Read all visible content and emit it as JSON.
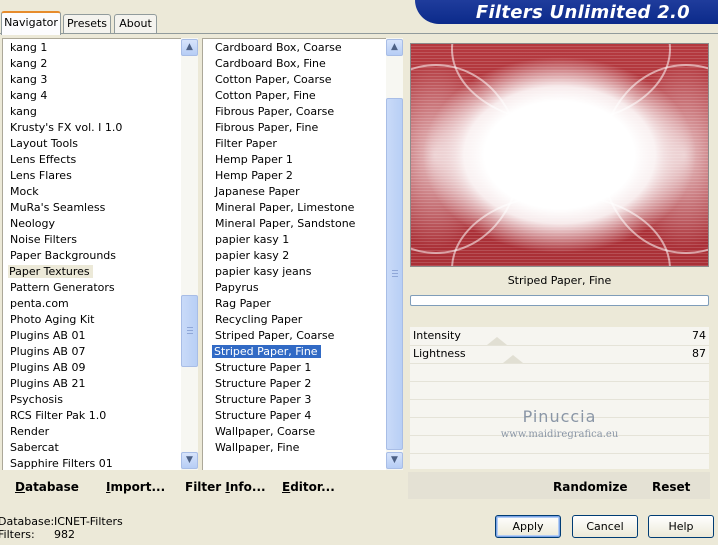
{
  "banner": {
    "title": "Filters Unlimited 2.0"
  },
  "tabs": [
    {
      "label": "Navigator",
      "active": true
    },
    {
      "label": "Presets",
      "active": false
    },
    {
      "label": "About",
      "active": false
    }
  ],
  "categories": {
    "items": [
      "kang 1",
      "kang 2",
      "kang 3",
      "kang 4",
      "kang",
      "Krusty's FX vol. I 1.0",
      "Layout Tools",
      "Lens Effects",
      "Lens Flares",
      "Mock",
      "MuRa's Seamless",
      "Neology",
      "Noise Filters",
      "Paper Backgrounds",
      "Paper Textures",
      "Pattern Generators",
      "penta.com",
      "Photo Aging Kit",
      "Plugins AB 01",
      "Plugins AB 07",
      "Plugins AB 09",
      "Plugins AB 21",
      "Psychosis",
      "RCS Filter Pak 1.0",
      "Render",
      "Sabercat",
      "Sapphire Filters 01"
    ],
    "selected": "Paper Textures"
  },
  "filters": {
    "items": [
      "Cardboard Box, Coarse",
      "Cardboard Box, Fine",
      "Cotton Paper, Coarse",
      "Cotton Paper, Fine",
      "Fibrous Paper, Coarse",
      "Fibrous Paper, Fine",
      "Filter Paper",
      "Hemp Paper 1",
      "Hemp Paper 2",
      "Japanese Paper",
      "Mineral Paper, Limestone",
      "Mineral Paper, Sandstone",
      "papier kasy 1",
      "papier kasy 2",
      "papier kasy jeans",
      "Papyrus",
      "Rag Paper",
      "Recycling Paper",
      "Striped Paper, Coarse",
      "Striped Paper, Fine",
      "Structure Paper 1",
      "Structure Paper 2",
      "Structure Paper 3",
      "Structure Paper 4",
      "Wallpaper, Coarse",
      "Wallpaper, Fine"
    ],
    "selected": "Striped Paper, Fine"
  },
  "preview": {
    "filter_name": "Striped Paper, Fine"
  },
  "sliders": [
    {
      "label": "Intensity",
      "value": "74"
    },
    {
      "label": "Lightness",
      "value": "87"
    }
  ],
  "watermark": {
    "name": "Pinuccia",
    "url": "www.maidiregrafica.eu"
  },
  "links": {
    "database": {
      "first": "D",
      "rest": "atabase"
    },
    "import": {
      "first": "I",
      "rest": "mport..."
    },
    "filter_info": {
      "pre": "Filter ",
      "u": "I",
      "post": "nfo..."
    },
    "editor": {
      "first": "E",
      "rest": "ditor..."
    },
    "randomize": "Randomize",
    "reset": "Reset"
  },
  "status": {
    "database_label": "Database:",
    "database_value": "ICNET-Filters",
    "filters_label": "Filters:",
    "filters_value": "982"
  },
  "buttons": {
    "apply": "Apply",
    "cancel": "Cancel",
    "help": "Help"
  },
  "colors": {
    "selection": "#316ac5",
    "banner": "#0b2a8a",
    "accent_tab": "#e68b2c"
  }
}
